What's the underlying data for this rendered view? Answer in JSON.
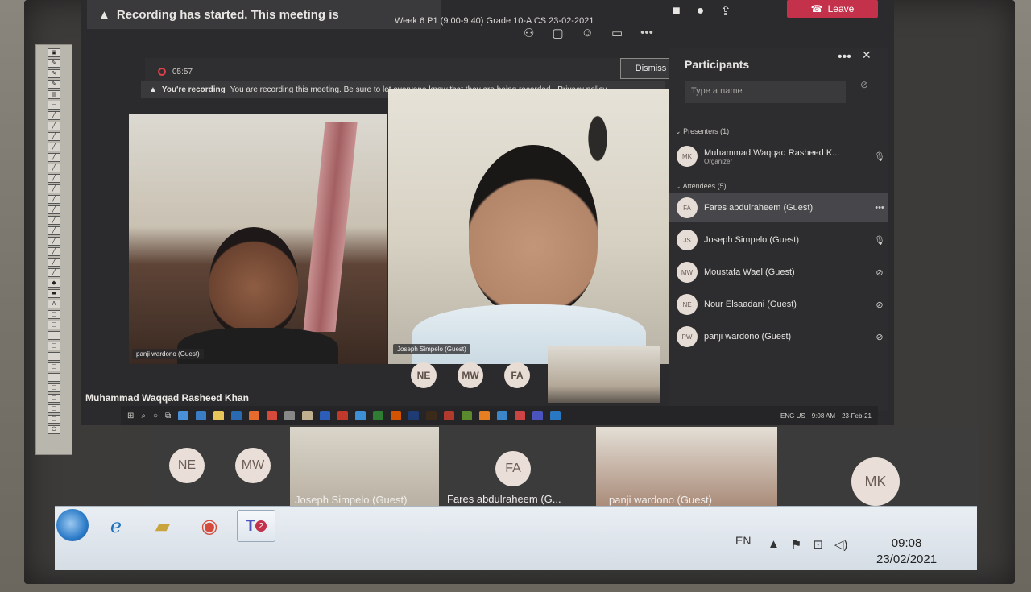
{
  "banner": {
    "text": "Recording has started.  This meeting is"
  },
  "meeting": {
    "title": "Week 6 P1 (9:00-9:40) Grade 10-A CS 23-02-2021"
  },
  "controls": {
    "leave_label": "Leave"
  },
  "recording": {
    "elapsed": "05:57",
    "title": "You're recording",
    "message": "You are recording this meeting. Be sure to let everyone know that they are being recorded.",
    "link": "Privacy policy",
    "dismiss": "Dismiss"
  },
  "stage": {
    "tile_left": "panji wardono (Guest)",
    "tile_right": "Joseph Simpelo (Guest)",
    "avatars": [
      "NE",
      "MW",
      "FA"
    ],
    "presenter_name": "Muhammad Waqqad Rasheed Khan"
  },
  "participants": {
    "title": "Participants",
    "search_placeholder": "Type a name",
    "presenters_label": "Presenters (1)",
    "attendees_label": "Attendees (5)",
    "presenter": {
      "initials": "MK",
      "name": "Muhammad Waqqad Rasheed K...",
      "role": "Organizer"
    },
    "attendees": [
      {
        "initials": "FA",
        "name": "Fares abdulraheem (Guest)"
      },
      {
        "initials": "JS",
        "name": "Joseph Simpelo (Guest)"
      },
      {
        "initials": "MW",
        "name": "Moustafa Wael (Guest)"
      },
      {
        "initials": "NE",
        "name": "Nour Elsaadani (Guest)"
      },
      {
        "initials": "PW",
        "name": "panji wardono (Guest)"
      }
    ]
  },
  "inner_tray": {
    "lang": "ENG US",
    "time": "9:08 AM",
    "date": "23-Feb-21"
  },
  "strip": {
    "avatar_ne": "NE",
    "avatar_mw": "MW",
    "tile_joseph": "Joseph Simpelo (Guest)",
    "avatar_fa": "FA",
    "tile_fares": "Fares abdulraheem (G...",
    "tile_panji": "panji wardono (Guest)",
    "avatar_mk": "MK"
  },
  "taskbar": {
    "teams_badge": "2",
    "lang": "EN",
    "time": "09:08",
    "date": "23/02/2021"
  },
  "icons": [
    "warning-icon",
    "camera-icon",
    "mic-icon",
    "share-icon",
    "participants-icon",
    "chat-icon",
    "reactions-icon",
    "rooms-icon",
    "more-icon",
    "close-icon",
    "phone-icon"
  ]
}
